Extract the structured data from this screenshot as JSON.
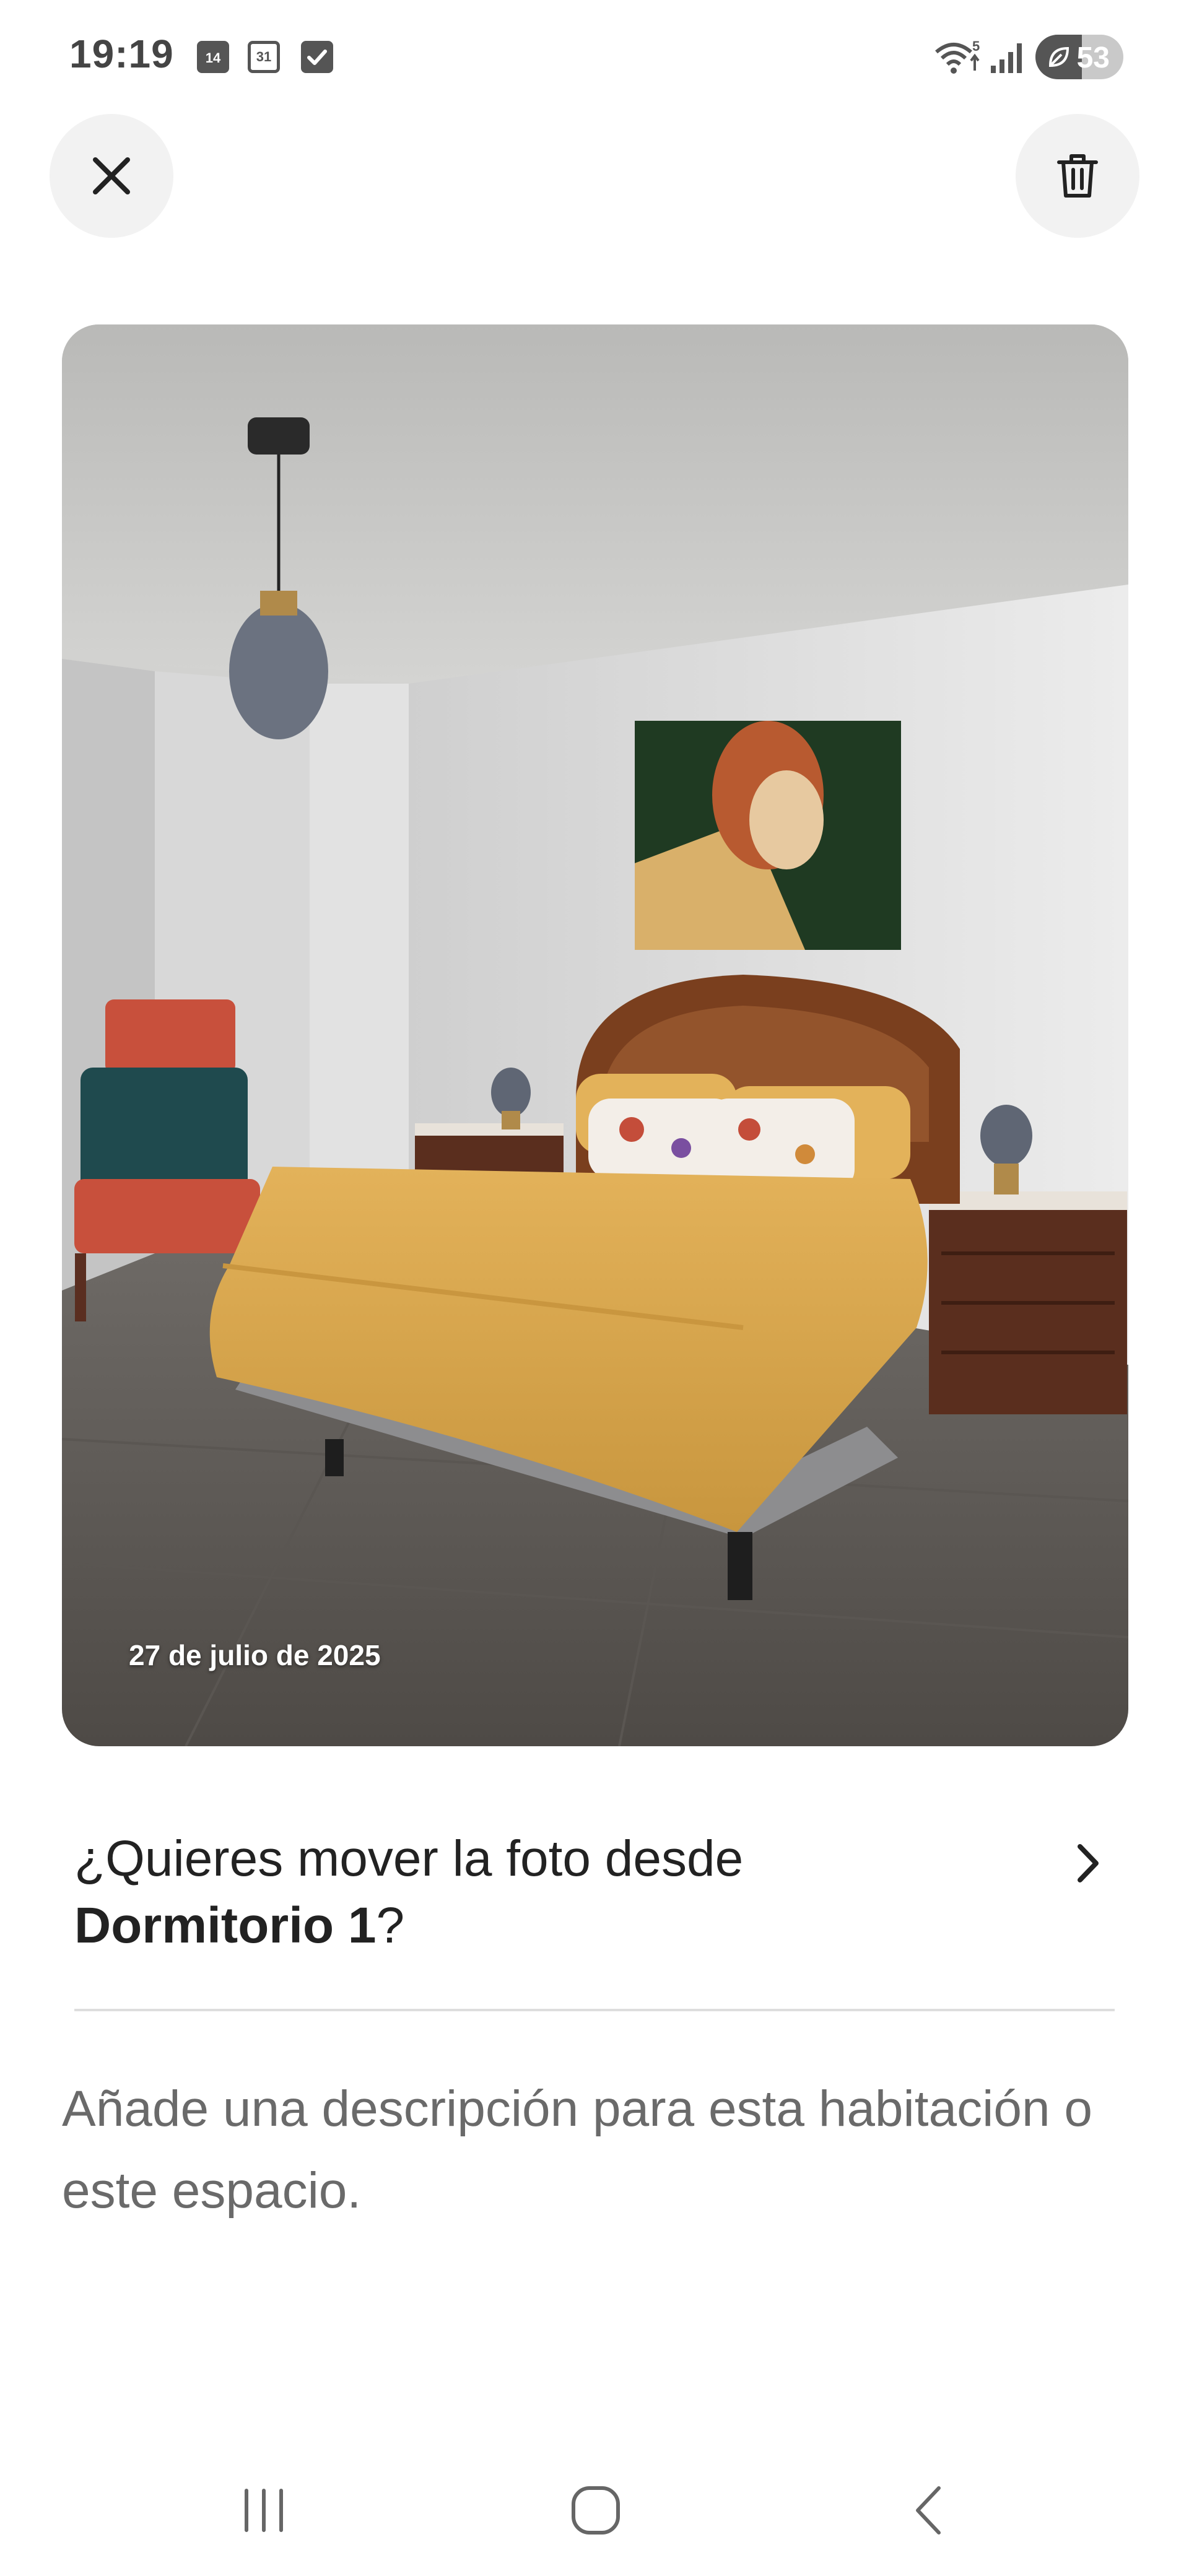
{
  "status_bar": {
    "time": "19:19",
    "calendar_icon_1_day": "14",
    "calendar_icon_2_day": "31",
    "wifi_badge": "5",
    "battery_level": "53",
    "battery_fraction": 0.53
  },
  "toolbar": {
    "close_icon": "close-icon",
    "delete_icon": "trash-icon"
  },
  "photo": {
    "date_label": "27 de julio de 2025",
    "subject": "bedroom-photo"
  },
  "move_prompt": {
    "text_before": "¿Quieres mover la foto desde ",
    "room_name": "Dormitorio 1",
    "text_after": "?",
    "icon": "chevron-right-icon"
  },
  "description": {
    "placeholder": "Añade una descripción para esta habitación o este espacio."
  },
  "nav_bar": {
    "recents_icon": "recents-icon",
    "home_icon": "home-icon",
    "back_icon": "back-icon"
  },
  "colors": {
    "text_primary": "#222222",
    "text_secondary": "#6a6a6a",
    "button_bg": "#f2f2f2",
    "divider": "#dddddd"
  }
}
